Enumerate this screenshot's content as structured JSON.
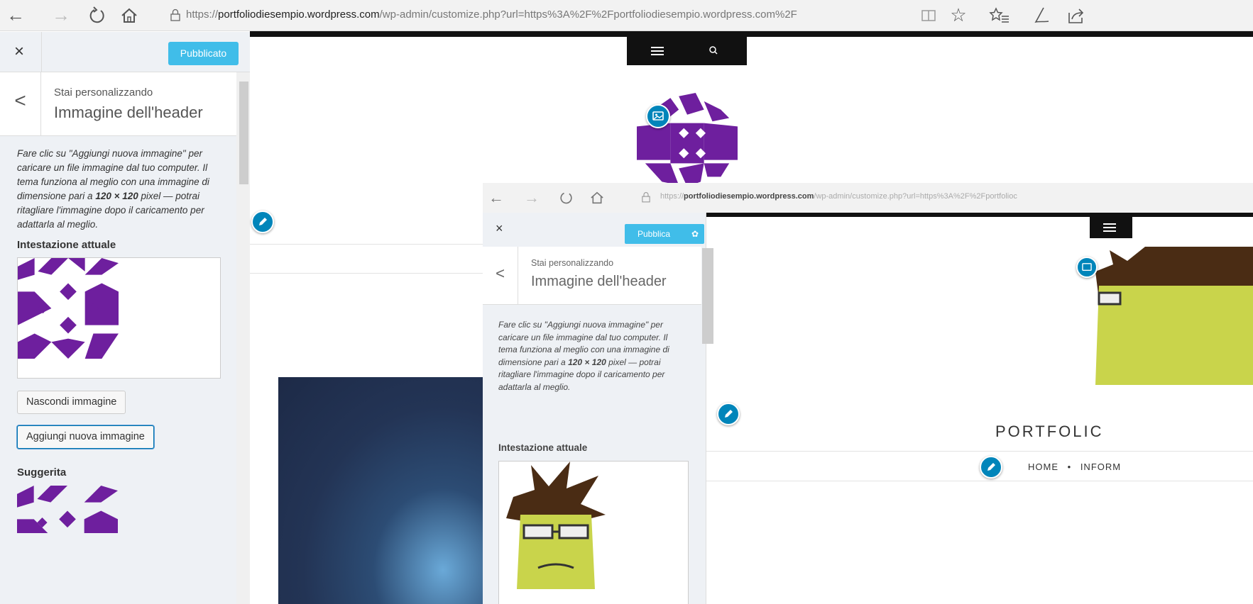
{
  "browser": {
    "url_prefix": "https://",
    "url_domain": "portfoliodiesempio.wordpress.com",
    "url_rest": "/wp-admin/customize.php?url=https%3A%2F%2Fportfoliodiesempio.wordpress.com%2F"
  },
  "panel": {
    "close_label": "×",
    "publish_label": "Pubblicato",
    "back_label": "<",
    "customizing_label": "Stai personalizzando",
    "section_title": "Immagine dell'header",
    "description_parts": [
      "Fare clic su \"Aggiungi nuova immagine\" per caricare un file immagine dal tuo computer. Il tema funziona al meglio con una immagine di dimensione pari a ",
      "120 × 120",
      " pixel — potrai ritagliare l'immagine dopo il caricamento per adattarla al meglio."
    ],
    "current_header_label": "Intestazione attuale",
    "hide_image_label": "Nascondi immagine",
    "add_image_label": "Aggiungi nuova immagine",
    "suggested_label": "Suggerita"
  },
  "inner": {
    "url_prefix": "https://",
    "url_domain": "portfoliodiesempio.wordpress.com",
    "url_rest": "/wp-admin/customize.php?url=https%3A%2F%2Fportfolioc",
    "close_label": "×",
    "publish_label": "Pubblica",
    "back_label": "<",
    "customizing_label": "Stai personalizzando",
    "section_title": "Immagine dell'header",
    "description_parts": [
      "Fare clic su \"Aggiungi nuova immagine\" per caricare un file immagine dal tuo computer. Il tema funziona al meglio con una immagine di dimensione pari a ",
      "120 ×",
      " ",
      "120",
      " pixel — potrai ritagliare l'immagine dopo il caricamento per adattarla al meglio."
    ],
    "current_header_label": "Intestazione attuale",
    "site_title": "PORTFOLIC",
    "nav_items": [
      "HOME",
      "•",
      "INFORM"
    ]
  },
  "colors": {
    "accent": "#40bde9",
    "edit_blue": "#0085ba",
    "identicon_purple": "#6e1f9e",
    "panel_bg": "#eef1f5"
  },
  "icons": [
    "back-arrow-icon",
    "forward-arrow-icon",
    "refresh-icon",
    "home-icon",
    "lock-icon",
    "reading-view-icon",
    "favorite-star-icon",
    "favorites-list-icon",
    "pen-notes-icon",
    "share-icon",
    "menu-icon",
    "search-icon",
    "image-icon",
    "pencil-icon",
    "gear-icon"
  ]
}
